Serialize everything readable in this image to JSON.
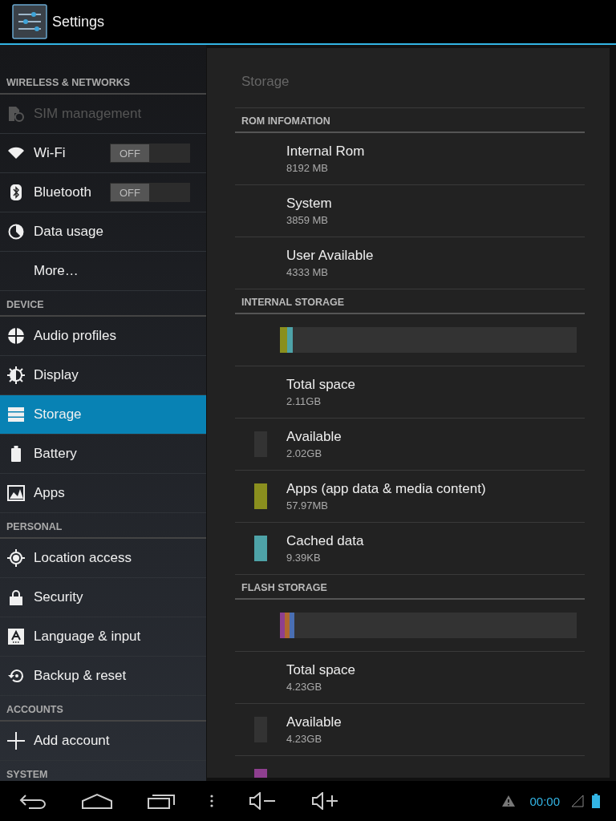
{
  "action_bar": {
    "title": "Settings"
  },
  "sidebar": {
    "sections": [
      {
        "header": "WIRELESS & NETWORKS",
        "items": [
          {
            "label": "SIM management",
            "kind": "plain",
            "disabled": true,
            "selected": false
          },
          {
            "label": "Wi-Fi",
            "kind": "toggle",
            "toggle": {
              "label": "OFF",
              "on": false
            },
            "disabled": false,
            "selected": false
          },
          {
            "label": "Bluetooth",
            "kind": "toggle",
            "toggle": {
              "label": "OFF",
              "on": false
            },
            "disabled": false,
            "selected": false
          },
          {
            "label": "Data usage",
            "kind": "plain",
            "disabled": false,
            "selected": false
          },
          {
            "label": "More…",
            "kind": "plain",
            "disabled": false,
            "selected": false
          }
        ]
      },
      {
        "header": "DEVICE",
        "items": [
          {
            "label": "Audio profiles",
            "kind": "plain",
            "disabled": false,
            "selected": false
          },
          {
            "label": "Display",
            "kind": "plain",
            "disabled": false,
            "selected": false
          },
          {
            "label": "Storage",
            "kind": "plain",
            "disabled": false,
            "selected": true
          },
          {
            "label": "Battery",
            "kind": "plain",
            "disabled": false,
            "selected": false
          },
          {
            "label": "Apps",
            "kind": "plain",
            "disabled": false,
            "selected": false
          }
        ]
      },
      {
        "header": "PERSONAL",
        "items": [
          {
            "label": "Location access",
            "kind": "plain",
            "disabled": false,
            "selected": false
          },
          {
            "label": "Security",
            "kind": "plain",
            "disabled": false,
            "selected": false
          },
          {
            "label": "Language & input",
            "kind": "plain",
            "disabled": false,
            "selected": false
          },
          {
            "label": "Backup & reset",
            "kind": "plain",
            "disabled": false,
            "selected": false
          }
        ]
      },
      {
        "header": "ACCOUNTS",
        "items": [
          {
            "label": "Add account",
            "kind": "plain",
            "disabled": false,
            "selected": false
          }
        ]
      },
      {
        "header": "SYSTEM"
      }
    ]
  },
  "detail": {
    "title": "Storage",
    "sections": [
      {
        "header": "ROM INFOMATION",
        "rows": [
          {
            "kind": "entry",
            "title": "Internal Rom",
            "value": "8192 MB"
          },
          {
            "kind": "entry",
            "title": "System",
            "value": "3859 MB"
          },
          {
            "kind": "entry",
            "title": "User Available",
            "value": "4333 MB"
          }
        ]
      },
      {
        "header": "INTERNAL STORAGE",
        "rows": [
          {
            "kind": "bar",
            "segments": [
              {
                "color": "#8a8f1e",
                "level": 0.025
              },
              {
                "color": "#4ea3a8",
                "level": 0.019
              }
            ]
          },
          {
            "kind": "entry",
            "title": "Total space",
            "value": "2.11GB"
          },
          {
            "kind": "entry",
            "title": "Available",
            "value": "2.02GB",
            "color": "#333333"
          },
          {
            "kind": "entry",
            "title": "Apps (app data & media content)",
            "value": "57.97MB",
            "color": "#8a8f1e"
          },
          {
            "kind": "entry",
            "title": "Cached data",
            "value": "9.39KB",
            "color": "#4ea3a8"
          }
        ]
      },
      {
        "header": "FLASH STORAGE",
        "rows": [
          {
            "kind": "bar",
            "segments": [
              {
                "color": "#8e3f8f",
                "level": 0.016
              },
              {
                "color": "#b0682e",
                "level": 0.016
              },
              {
                "color": "#4a6fb3",
                "level": 0.016
              }
            ]
          },
          {
            "kind": "entry",
            "title": "Total space",
            "value": "4.23GB"
          },
          {
            "kind": "entry",
            "title": "Available",
            "value": "4.23GB",
            "color": "#333333"
          },
          {
            "kind": "swatch",
            "color": "#8e3f8f"
          }
        ]
      }
    ]
  },
  "status_bar": {
    "time": "00:00"
  }
}
